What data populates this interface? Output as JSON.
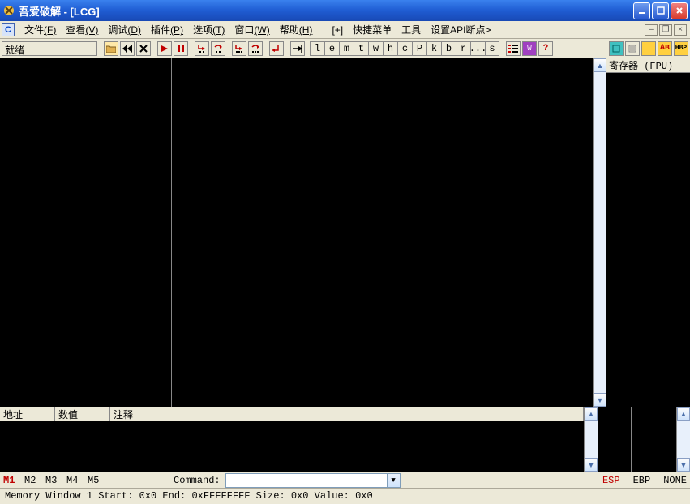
{
  "window": {
    "title": "吾爱破解 - [LCG]"
  },
  "menu": {
    "c_icon": "C",
    "items": [
      {
        "label": "文件",
        "hotkey": "(F)"
      },
      {
        "label": "查看",
        "hotkey": "(V)"
      },
      {
        "label": "调试",
        "hotkey": "(D)"
      },
      {
        "label": "插件",
        "hotkey": "(P)"
      },
      {
        "label": "选项",
        "hotkey": "(T)"
      },
      {
        "label": "窗口",
        "hotkey": "(W)"
      },
      {
        "label": "帮助",
        "hotkey": "(H)"
      },
      {
        "label": "[+]",
        "hotkey": ""
      },
      {
        "label": "快捷菜单",
        "hotkey": ""
      },
      {
        "label": "工具",
        "hotkey": ""
      },
      {
        "label": "设置API断点>",
        "hotkey": ""
      }
    ]
  },
  "toolbar": {
    "status_text": "就绪",
    "letter_buttons": [
      "l",
      "e",
      "m",
      "t",
      "w",
      "h",
      "c",
      "P",
      "k",
      "b",
      "r",
      "...",
      "s"
    ],
    "help": "?",
    "hbp": "HBP",
    "ab": "Aв"
  },
  "registers": {
    "header": "寄存器 (FPU)"
  },
  "dump": {
    "col_addr": "地址",
    "col_value": "数值",
    "col_comment": "注释"
  },
  "mrow": {
    "buttons": [
      "M1",
      "M2",
      "M3",
      "M4",
      "M5"
    ],
    "command_label": "Command:",
    "esp": "ESP",
    "ebp": "EBP",
    "none": "NONE"
  },
  "status": {
    "text": "Memory Window 1  Start: 0x0  End: 0xFFFFFFFF  Size: 0x0 Value: 0x0"
  }
}
